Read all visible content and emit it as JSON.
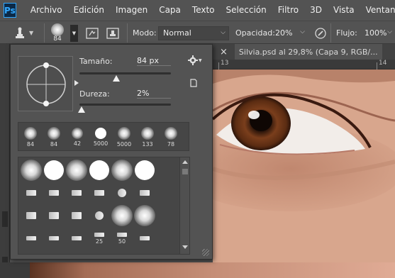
{
  "app": {
    "logo": "Ps"
  },
  "menu": [
    "Archivo",
    "Edición",
    "Imagen",
    "Capa",
    "Texto",
    "Selección",
    "Filtro",
    "3D",
    "Vista",
    "Ventana"
  ],
  "options": {
    "brush_size_value": "84",
    "mode_label": "Modo:",
    "mode_value": "Normal",
    "opacity_label": "Opacidad:",
    "opacity_value": "20%",
    "flow_label": "Flujo:",
    "flow_value": "100%"
  },
  "document": {
    "tab_close": "×",
    "tab_title": "Silvia.psd al 29,8% (Capa 9, RGB/...",
    "ruler_numbers": [
      "13",
      "14"
    ]
  },
  "brush_popup": {
    "size_label": "Tamaño:",
    "size_value": "84 px",
    "size_fraction": 0.4,
    "hardness_label": "Dureza:",
    "hardness_value": "2%",
    "hardness_fraction": 0.02,
    "recent": [
      "84",
      "84",
      "42",
      "5000",
      "5000",
      "133",
      "78"
    ],
    "grid_numbers": [
      "25",
      "50"
    ]
  },
  "colors": {
    "accent": "#31a8ff",
    "panel": "#535353",
    "dark": "#3d3d3d"
  }
}
